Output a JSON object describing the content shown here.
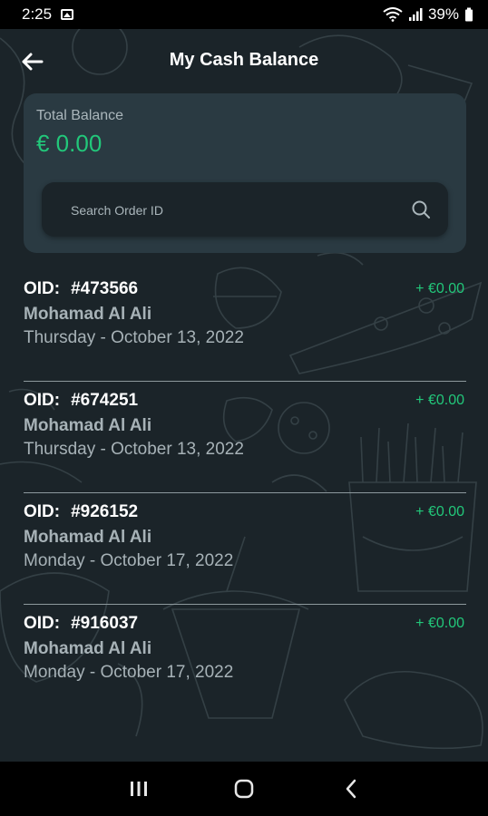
{
  "status_bar": {
    "time": "2:25",
    "battery": "39%"
  },
  "header": {
    "title": "My Cash Balance"
  },
  "balance": {
    "label": "Total Balance",
    "value": "€ 0.00"
  },
  "search": {
    "placeholder": "Search Order ID"
  },
  "orders": [
    {
      "oid_label": "OID:",
      "oid": "#473566",
      "customer": "Mohamad Al Ali",
      "date": "Thursday - October 13, 2022",
      "amount": "+ €0.00"
    },
    {
      "oid_label": "OID:",
      "oid": "#674251",
      "customer": "Mohamad Al Ali",
      "date": "Thursday - October 13, 2022",
      "amount": "+ €0.00"
    },
    {
      "oid_label": "OID:",
      "oid": "#926152",
      "customer": "Mohamad Al Ali",
      "date": "Monday - October 17, 2022",
      "amount": "+ €0.00"
    },
    {
      "oid_label": "OID:",
      "oid": "#916037",
      "customer": "Mohamad Al Ali",
      "date": "Monday - October 17, 2022",
      "amount": "+ €0.00"
    }
  ],
  "colors": {
    "background": "#1b2429",
    "card": "#2a3a42",
    "accent_green": "#22c77a",
    "muted_text": "#a7b2b7"
  },
  "icons": {
    "back": "arrow-left-icon",
    "search": "search-icon",
    "nav_recent": "recent-apps-icon",
    "nav_home": "home-icon",
    "nav_back": "chevron-left-icon"
  }
}
